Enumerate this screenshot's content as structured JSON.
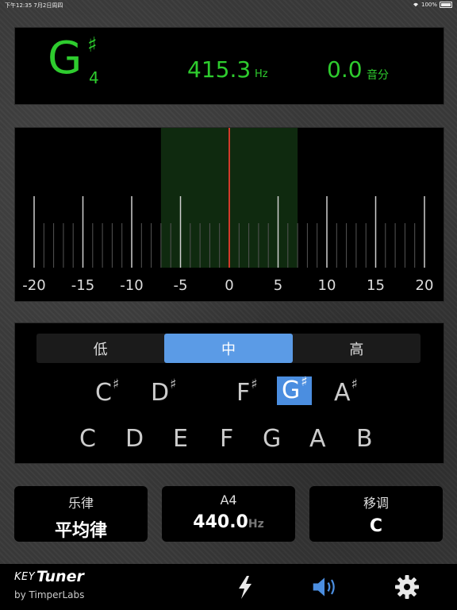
{
  "status_bar": {
    "time": "下午12:35",
    "date": "7月2日周四",
    "battery": "100%"
  },
  "header": {
    "note_letter": "G",
    "note_accidental": "♯",
    "note_octave": "4",
    "frequency": "415.3",
    "frequency_unit": "Hz",
    "cents": "0.0",
    "cents_unit": "音分"
  },
  "meter": {
    "tick_labels": [
      "-20",
      "-15",
      "-10",
      "-5",
      "0",
      "5",
      "10",
      "15",
      "20"
    ],
    "needle_value": 0,
    "range": [
      -20,
      20
    ],
    "in_tune_zone": [
      -7,
      7
    ],
    "colors": {
      "zone": "#0f2a0f",
      "needle": "#d23a2a",
      "ticks": "#cfcfcf"
    }
  },
  "octave_selector": {
    "options": [
      {
        "label": "低",
        "active": false
      },
      {
        "label": "中",
        "active": true
      },
      {
        "label": "高",
        "active": false
      }
    ]
  },
  "keys": {
    "sharps": [
      {
        "name": "C",
        "acc": "♯",
        "selected": false
      },
      {
        "name": "D",
        "acc": "♯",
        "selected": false
      },
      {
        "name": "F",
        "acc": "♯",
        "selected": false
      },
      {
        "name": "G",
        "acc": "♯",
        "selected": true
      },
      {
        "name": "A",
        "acc": "♯",
        "selected": false
      }
    ],
    "naturals": [
      "C",
      "D",
      "E",
      "F",
      "G",
      "A",
      "B"
    ]
  },
  "settings": {
    "temperament": {
      "label": "乐律",
      "value": "平均律"
    },
    "pitch": {
      "label": "A4",
      "value": "440.0",
      "unit": "Hz"
    },
    "transpose": {
      "label": "移调",
      "value": "C"
    }
  },
  "footer": {
    "brand_key": "KEY",
    "brand_tuner": "Tuner",
    "brand_by": "by TimperLabs",
    "icons": [
      "lightning-icon",
      "speaker-icon",
      "gear-icon"
    ],
    "accent_color": "#4b8ee0"
  }
}
